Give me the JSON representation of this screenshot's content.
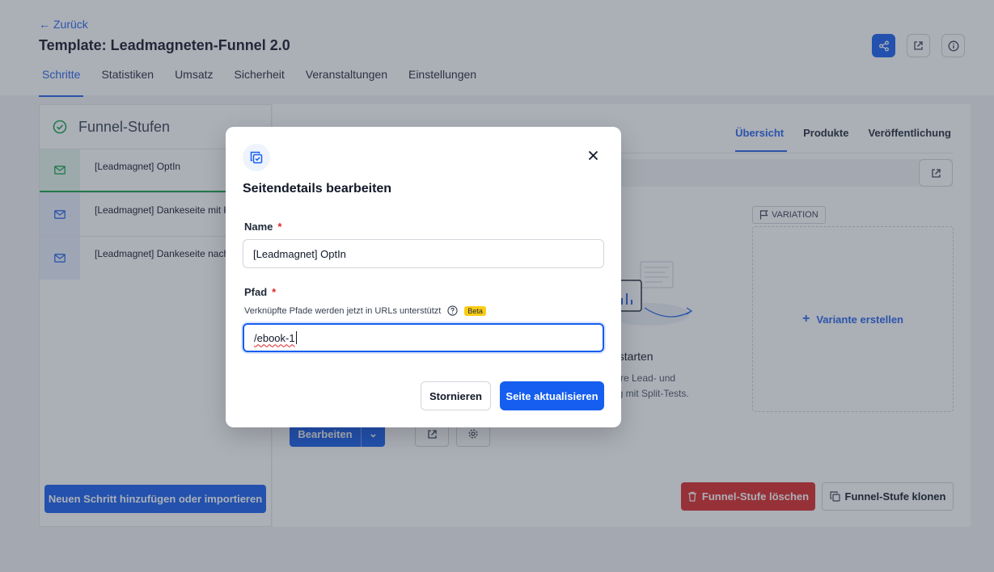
{
  "header": {
    "back_label": "Zurück",
    "title": "Template: Leadmagneten-Funnel 2.0",
    "tabs": [
      "Schritte",
      "Statistiken",
      "Umsatz",
      "Sicherheit",
      "Veranstaltungen",
      "Einstellungen"
    ]
  },
  "sidebar": {
    "title": "Funnel-Stufen",
    "steps": [
      {
        "label": "[Leadmagnet] OptIn"
      },
      {
        "label": "[Leadmagnet] Dankeseite mit Kalender"
      },
      {
        "label": "[Leadmagnet] Dankeseite nach Termin"
      }
    ],
    "add_button": "Neuen Schritt hinzufügen oder importieren"
  },
  "main": {
    "subtabs": [
      "Übersicht",
      "Produkte",
      "Veröffentlichung"
    ],
    "variation_label": "VARIATION",
    "create_variant": "Variante erstellen",
    "split_title_partial": "t starten",
    "split_desc_line1": "Ihre Lead- und",
    "split_desc_line2": "ng mit Split-Tests.",
    "edit_button": "Bearbeiten",
    "delete_button": "Funnel-Stufe löschen",
    "clone_button": "Funnel-Stufe klonen"
  },
  "modal": {
    "title": "Seitendetails bearbeiten",
    "name_label": "Name",
    "name_value": "[Leadmagnet] OptIn",
    "path_label": "Pfad",
    "path_hint": "Verknüpfte Pfade werden jetzt in URLs unterstützt",
    "beta_badge": "Beta",
    "path_value": "/ebook-1",
    "cancel_button": "Stornieren",
    "update_button": "Seite aktualisieren"
  },
  "colors": {
    "primary": "#155eef",
    "danger": "#dc2626",
    "success": "#16a34a",
    "beta": "#facc15"
  }
}
